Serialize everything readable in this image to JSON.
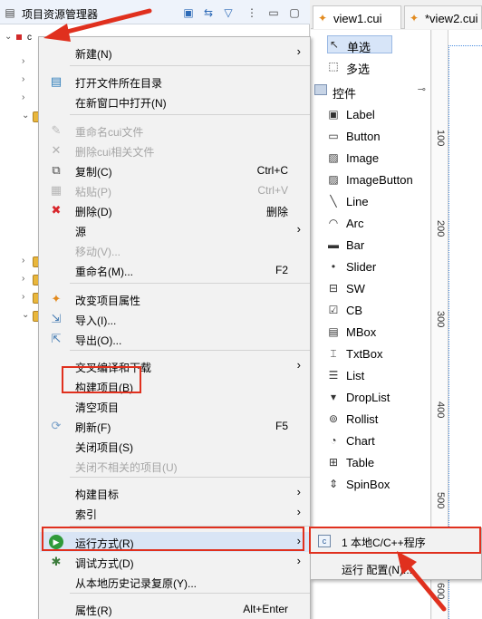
{
  "explorer": {
    "title": "项目资源管理器",
    "root_label": "c"
  },
  "editor": {
    "tabs": [
      {
        "label": "view1.cui"
      },
      {
        "label": "*view2.cui"
      }
    ]
  },
  "palette": {
    "tools": [
      {
        "label": "单选",
        "icon": "cursor-icon"
      },
      {
        "label": "多选",
        "icon": "marquee-icon"
      }
    ],
    "section": "控件",
    "controls": [
      {
        "label": "Label",
        "icon": "label-icon"
      },
      {
        "label": "Button",
        "icon": "button-icon"
      },
      {
        "label": "Image",
        "icon": "image-icon"
      },
      {
        "label": "ImageButton",
        "icon": "image-button-icon"
      },
      {
        "label": "Line",
        "icon": "line-icon"
      },
      {
        "label": "Arc",
        "icon": "arc-icon"
      },
      {
        "label": "Bar",
        "icon": "bar-icon"
      },
      {
        "label": "Slider",
        "icon": "slider-icon"
      },
      {
        "label": "SW",
        "icon": "switch-icon"
      },
      {
        "label": "CB",
        "icon": "checkbox-icon"
      },
      {
        "label": "MBox",
        "icon": "msgbox-icon"
      },
      {
        "label": "TxtBox",
        "icon": "textbox-icon"
      },
      {
        "label": "List",
        "icon": "list-icon"
      },
      {
        "label": "DropList",
        "icon": "droplist-icon"
      },
      {
        "label": "Rollist",
        "icon": "rollist-icon"
      },
      {
        "label": "Chart",
        "icon": "chart-icon"
      },
      {
        "label": "Table",
        "icon": "table-icon"
      },
      {
        "label": "SpinBox",
        "icon": "spinbox-icon"
      }
    ]
  },
  "ruler": {
    "ticks": [
      "100",
      "200",
      "300",
      "400",
      "500",
      "600"
    ]
  },
  "context_menu": {
    "items": [
      {
        "label": "新建(N)",
        "shortcut": "",
        "submenu": true,
        "disabled": false,
        "icon": ""
      },
      {
        "label": "打开文件所在目录",
        "shortcut": "",
        "submenu": false,
        "disabled": false,
        "icon": "open-folder-icon"
      },
      {
        "label": "在新窗口中打开(N)",
        "shortcut": "",
        "submenu": false,
        "disabled": false,
        "icon": ""
      },
      {
        "label": "重命名cui文件",
        "shortcut": "",
        "submenu": false,
        "disabled": true,
        "icon": "rename-icon"
      },
      {
        "label": "删除cui相关文件",
        "shortcut": "",
        "submenu": false,
        "disabled": true,
        "icon": "delete-gray-icon"
      },
      {
        "label": "复制(C)",
        "shortcut": "Ctrl+C",
        "submenu": false,
        "disabled": false,
        "icon": "copy-icon"
      },
      {
        "label": "粘贴(P)",
        "shortcut": "Ctrl+V",
        "submenu": false,
        "disabled": true,
        "icon": "paste-icon"
      },
      {
        "label": "删除(D)",
        "shortcut": "删除",
        "submenu": false,
        "disabled": false,
        "icon": "delete-icon"
      },
      {
        "label": "源",
        "shortcut": "",
        "submenu": true,
        "disabled": false,
        "icon": ""
      },
      {
        "label": "移动(V)...",
        "shortcut": "",
        "submenu": false,
        "disabled": true,
        "icon": ""
      },
      {
        "label": "重命名(M)...",
        "shortcut": "F2",
        "submenu": false,
        "disabled": false,
        "icon": ""
      },
      {
        "label": "改变项目属性",
        "shortcut": "",
        "submenu": false,
        "disabled": false,
        "icon": "project-props-icon"
      },
      {
        "label": "导入(I)...",
        "shortcut": "",
        "submenu": false,
        "disabled": false,
        "icon": "import-icon"
      },
      {
        "label": "导出(O)...",
        "shortcut": "",
        "submenu": false,
        "disabled": false,
        "icon": "export-icon"
      },
      {
        "label": "交叉编译和下载",
        "shortcut": "",
        "submenu": true,
        "disabled": false,
        "icon": ""
      },
      {
        "label": "构建项目(B)",
        "shortcut": "",
        "submenu": false,
        "disabled": false,
        "icon": ""
      },
      {
        "label": "清空项目",
        "shortcut": "",
        "submenu": false,
        "disabled": false,
        "icon": ""
      },
      {
        "label": "刷新(F)",
        "shortcut": "F5",
        "submenu": false,
        "disabled": false,
        "icon": "refresh-icon"
      },
      {
        "label": "关闭项目(S)",
        "shortcut": "",
        "submenu": false,
        "disabled": false,
        "icon": ""
      },
      {
        "label": "关闭不相关的项目(U)",
        "shortcut": "",
        "submenu": false,
        "disabled": true,
        "icon": ""
      },
      {
        "label": "构建目标",
        "shortcut": "",
        "submenu": true,
        "disabled": false,
        "icon": ""
      },
      {
        "label": "索引",
        "shortcut": "",
        "submenu": true,
        "disabled": false,
        "icon": ""
      },
      {
        "label": "运行方式(R)",
        "shortcut": "",
        "submenu": true,
        "disabled": false,
        "icon": "run-icon"
      },
      {
        "label": "调试方式(D)",
        "shortcut": "",
        "submenu": true,
        "disabled": false,
        "icon": "debug-icon"
      },
      {
        "label": "从本地历史记录复原(Y)...",
        "shortcut": "",
        "submenu": false,
        "disabled": false,
        "icon": ""
      },
      {
        "label": "属性(R)",
        "shortcut": "Alt+Enter",
        "submenu": false,
        "disabled": false,
        "icon": ""
      }
    ]
  },
  "submenu": {
    "items": [
      {
        "label": "1 本地C/C++程序",
        "icon": "c-app-icon"
      },
      {
        "label": "运行 配置(N)...",
        "icon": ""
      }
    ]
  },
  "colors": {
    "annotation_red": "#e0301e",
    "highlight": "#d9e5f5"
  }
}
